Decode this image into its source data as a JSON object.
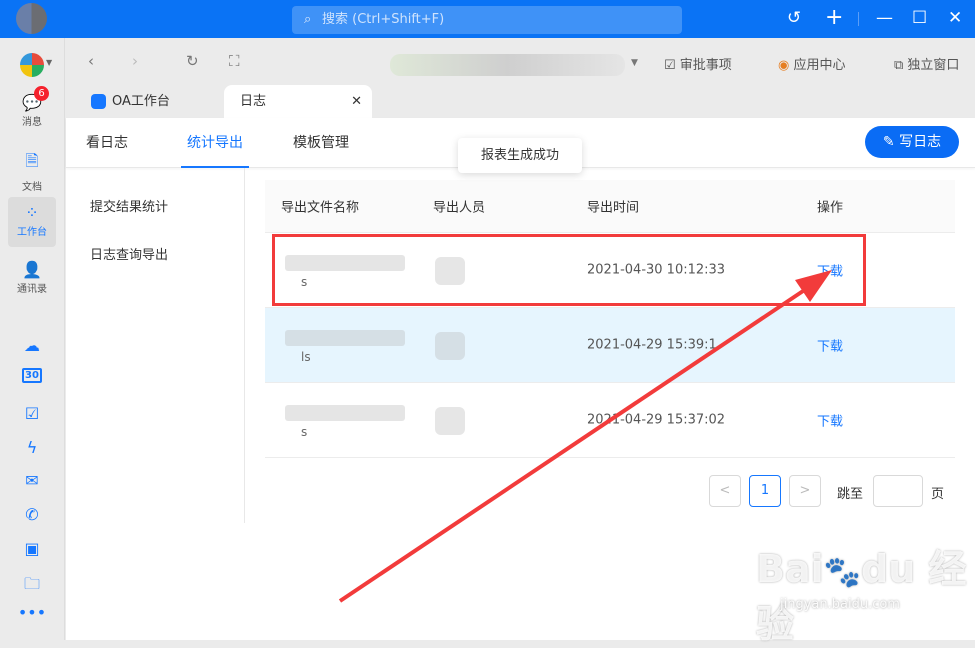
{
  "topbar": {
    "search_placeholder": "搜索 (Ctrl+Shift+F)",
    "icons": [
      "history-icon",
      "plus-icon",
      "minimize-icon",
      "maximize-icon",
      "close-icon"
    ]
  },
  "sidebar": {
    "items": [
      {
        "label": "消息",
        "badge": "6",
        "icon": "message-icon"
      },
      {
        "label": "文档",
        "icon": "document-icon"
      },
      {
        "label": "工作台",
        "icon": "workbench-icon"
      },
      {
        "label": "通讯录",
        "icon": "contacts-icon"
      }
    ],
    "extra_icons": [
      "cloud-icon",
      "calendar-icon",
      "task-icon",
      "lightning-icon",
      "mail-icon",
      "phone-video-icon",
      "box-icon",
      "folder-icon",
      "more-icon"
    ],
    "calendar_text": "30"
  },
  "nav": {
    "links": [
      "审批事项",
      "应用中心",
      "独立窗口"
    ]
  },
  "tabs": [
    {
      "label": "OA工作台"
    },
    {
      "label": "日志"
    }
  ],
  "subtabs": [
    "看日志",
    "统计导出",
    "模板管理"
  ],
  "write_button": "写日志",
  "left_menu": [
    "提交结果统计",
    "日志查询导出"
  ],
  "toast": "报表生成成功",
  "table": {
    "headers": [
      "导出文件名称",
      "导出人员",
      "导出时间",
      "操作"
    ],
    "rows": [
      {
        "ext": "s",
        "time": "2021-04-30 10:12:33",
        "action": "下载"
      },
      {
        "ext": "ls",
        "time": "2021-04-29 15:39:1",
        "action": "下载"
      },
      {
        "ext": "s",
        "time": "2021-04-29 15:37:02",
        "action": "下载"
      }
    ]
  },
  "pagination": {
    "prev": "<",
    "page": "1",
    "next": ">",
    "jump_label": "跳至",
    "jump_value": "",
    "page_suffix": "页"
  },
  "watermark": {
    "logo": "Bai du 经验",
    "url": "jingyan.baidu.com"
  },
  "colors": {
    "primary": "#0a73f5",
    "highlight_row": "#e6f5fe",
    "annotation": "#f23b3b"
  }
}
